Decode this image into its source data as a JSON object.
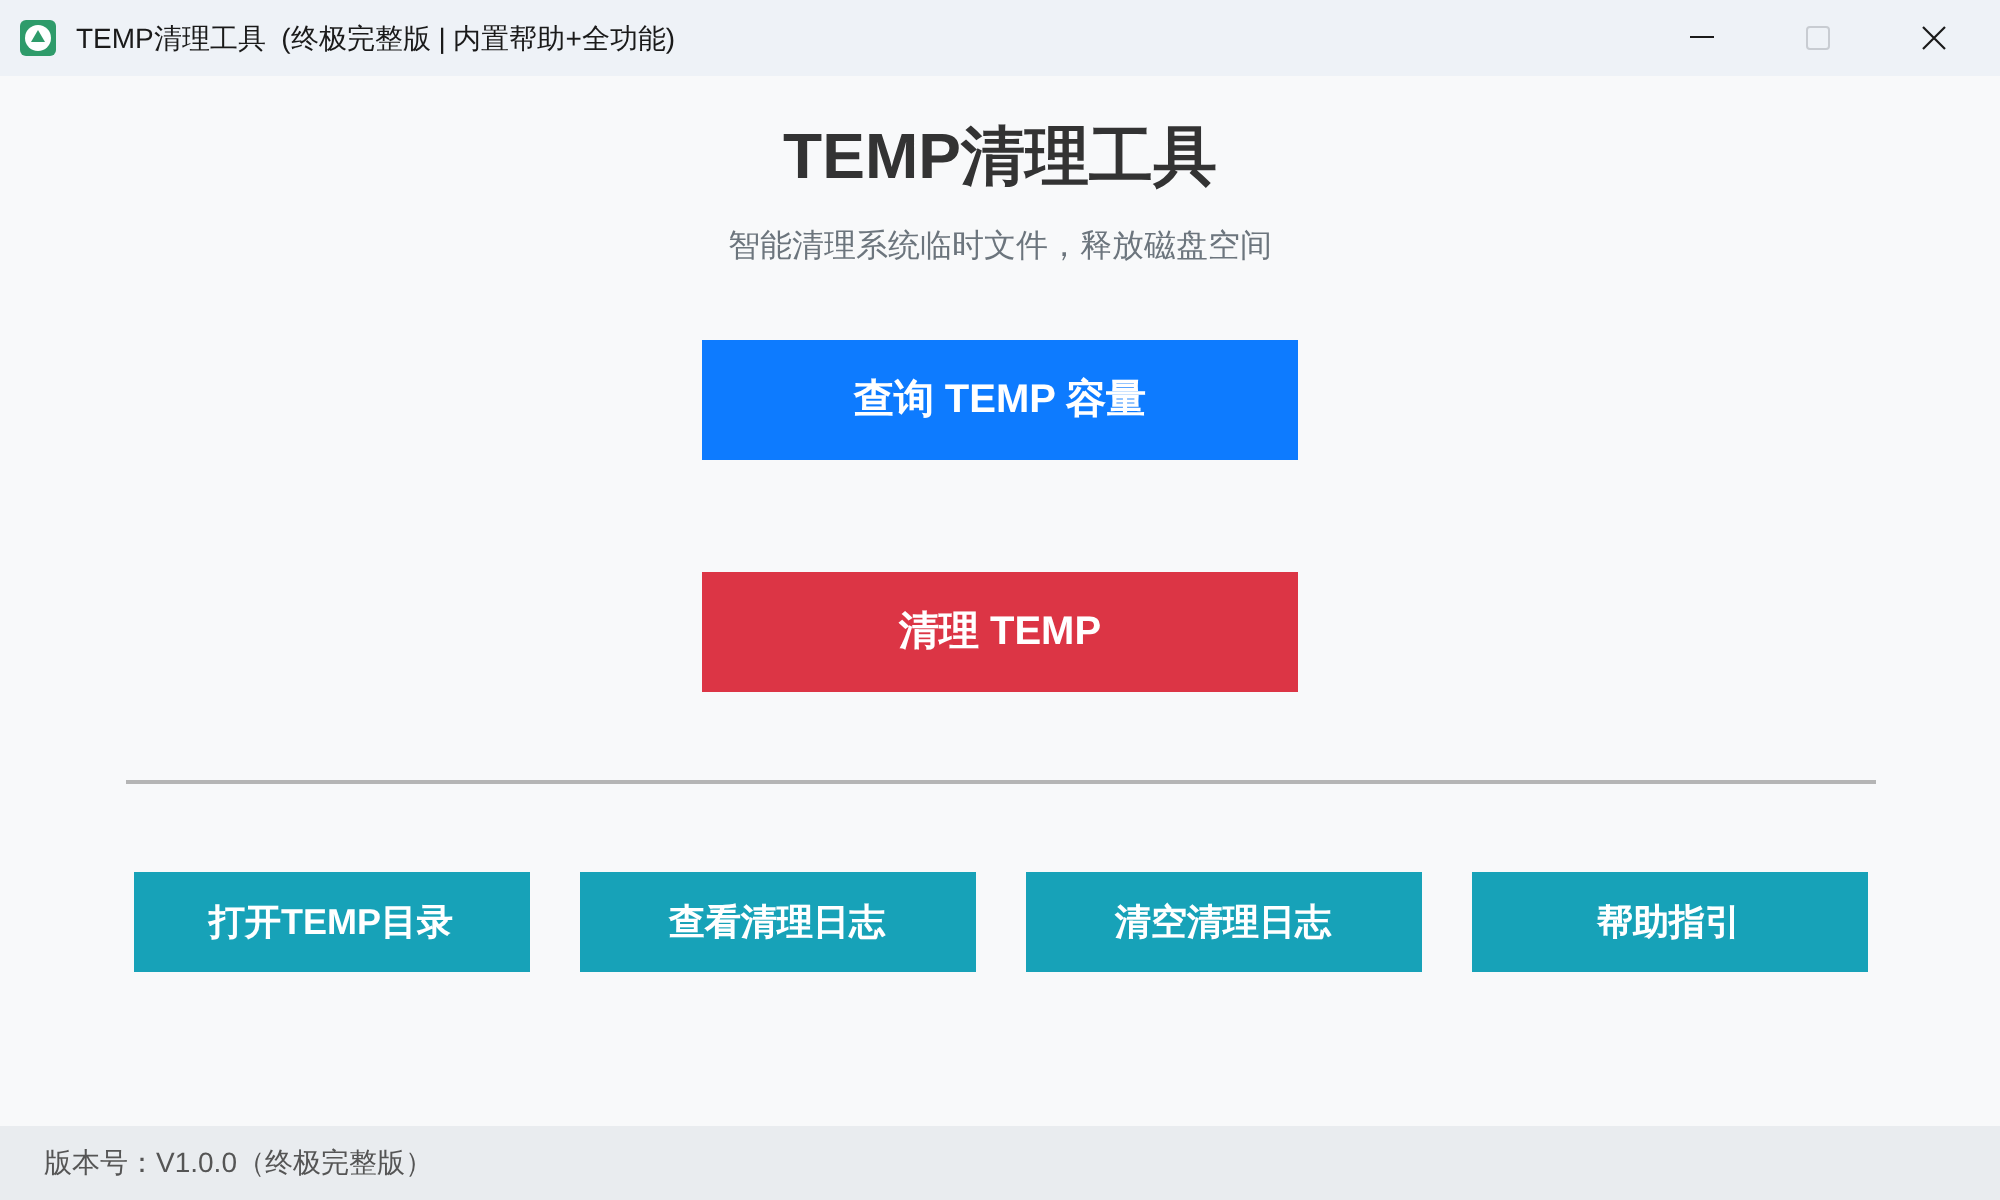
{
  "window": {
    "title": "TEMP清理工具  (终极完整版 | 内置帮助+全功能)",
    "controls": [
      {
        "kind": "minimize",
        "disabled": false
      },
      {
        "kind": "maximize",
        "disabled": true
      },
      {
        "kind": "close",
        "disabled": false
      }
    ]
  },
  "header": {
    "title": "TEMP清理工具",
    "subtitle": "智能清理系统临时文件，释放磁盘空间"
  },
  "main_buttons": [
    {
      "label": "查询 TEMP 容量",
      "kind": "primary"
    },
    {
      "label": "清理 TEMP",
      "kind": "danger"
    }
  ],
  "tool_buttons": [
    {
      "label": "打开TEMP目录"
    },
    {
      "label": "查看清理日志"
    },
    {
      "label": "清空清理日志"
    },
    {
      "label": "帮助指引"
    }
  ],
  "status_bar": {
    "text": "版本号：V1.0.0（终极完整版）"
  }
}
